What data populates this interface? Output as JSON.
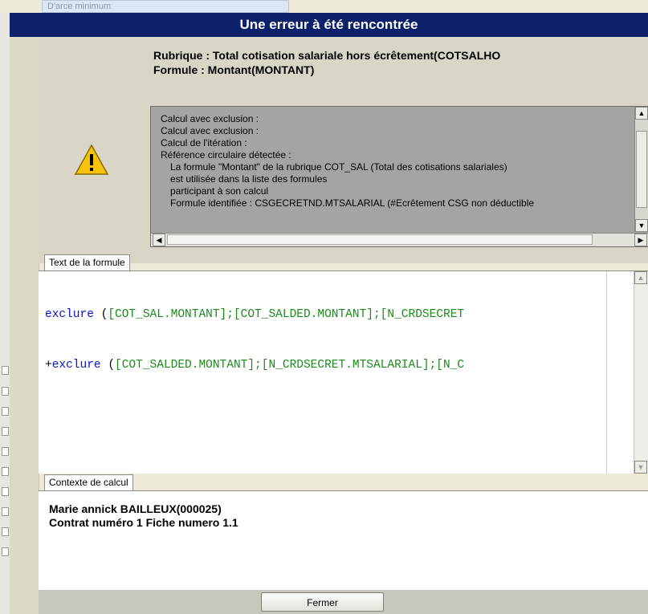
{
  "background": {
    "field_text": "D'arce minimum"
  },
  "dialog": {
    "title": "Une erreur à été rencontrée",
    "rubrique_line": "Rubrique : Total cotisation salariale hors écrêtement(COTSALHO",
    "formule_line": "Formule : Montant(MONTANT)",
    "warning_icon": "warning-triangle-icon",
    "message_lines": [
      "Calcul avec exclusion :",
      "Calcul avec exclusion :",
      "Calcul de l'itération :",
      "Référence circulaire détectée :",
      "La formule \"Montant\" de la rubrique COT_SAL (Total des cotisations salariales)",
      "est utilisée dans la liste des formules",
      "participant à son calcul",
      "Formule identifiée : CSGECRETND.MTSALARIAL (#Ecrêtement CSG non déductible"
    ],
    "formula_tab": "Text de la formule",
    "formula_lines": [
      {
        "func": "exclure",
        "open": " (",
        "args": "[COT_SAL.MONTANT];[COT_SALDED.MONTANT];[N_CRDSECRET"
      },
      {
        "prefix": "+",
        "func": "exclure",
        "open": " (",
        "args": "[COT_SALDED.MONTANT];[N_CRDSECRET.MTSALARIAL];[N_C"
      }
    ],
    "context_tab": "Contexte de calcul",
    "context_lines": [
      "Marie annick BAILLEUX(000025)",
      "Contrat numéro 1 Fiche numero 1.1"
    ],
    "close_button": "Fermer"
  },
  "colors": {
    "titlebar": "#0c2169",
    "keyword": "#0c14c8",
    "field_ref": "#1d8a1d"
  }
}
